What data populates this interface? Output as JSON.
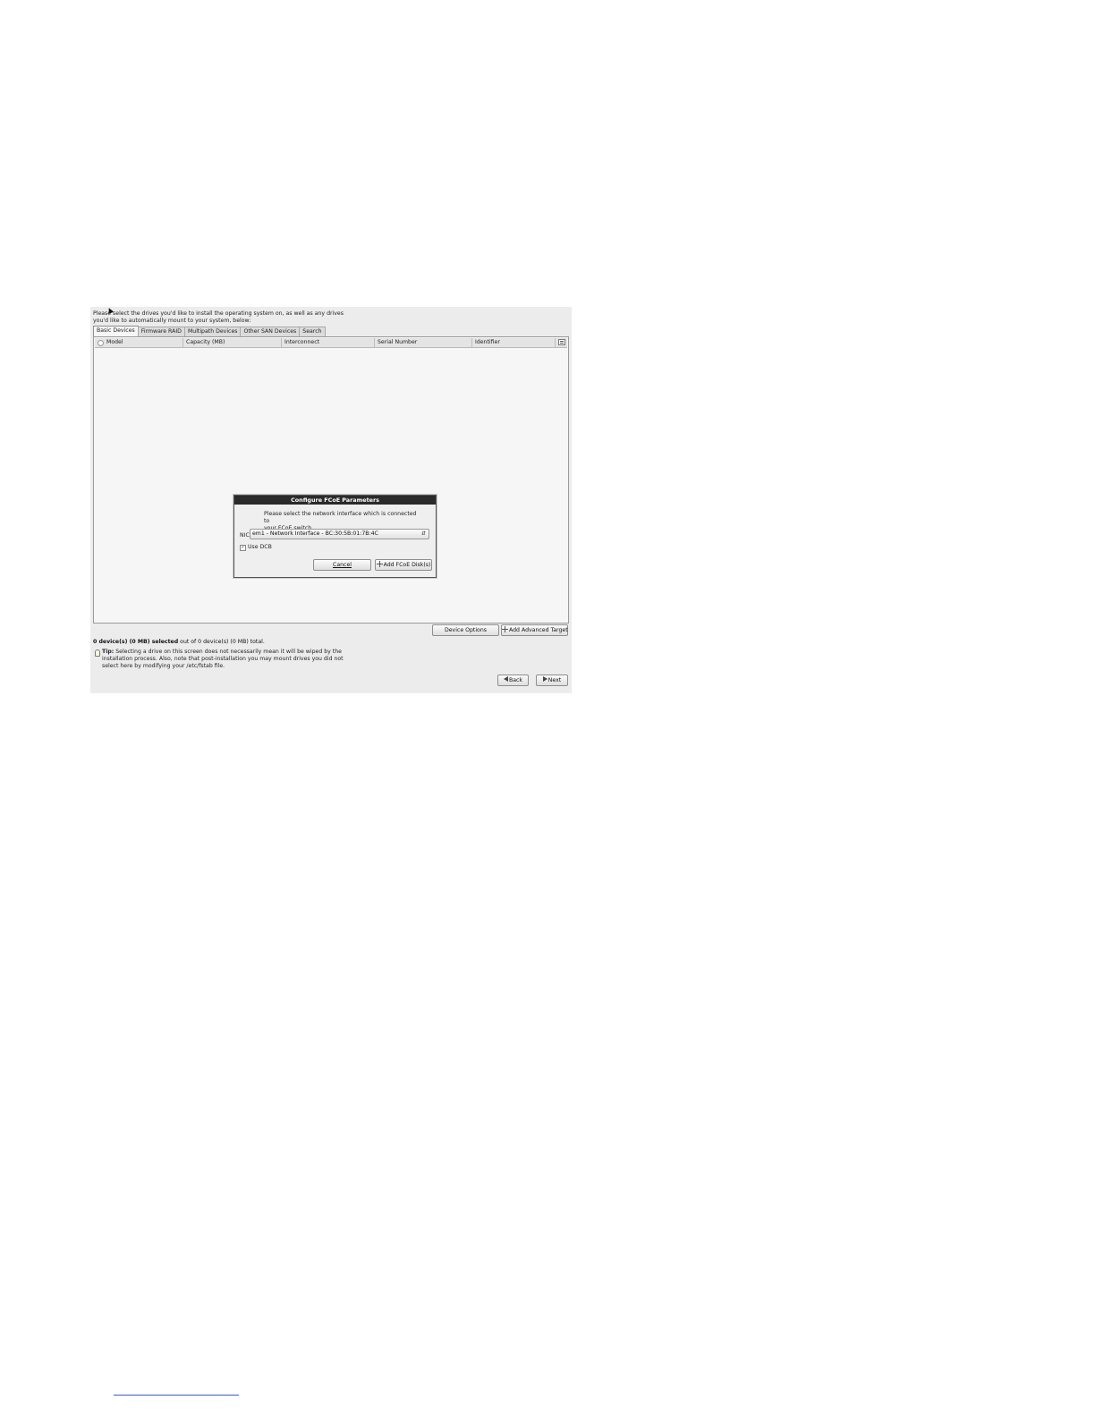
{
  "instruction": {
    "line1": "Please select the drives you'd like to install the operating system on, as well as any drives",
    "line2": "you'd like to automatically mount to your system, below:"
  },
  "tabs": [
    {
      "label": "Basic Devices",
      "active": true
    },
    {
      "label": "Firmware RAID",
      "active": false
    },
    {
      "label": "Multipath Devices",
      "active": false
    },
    {
      "label": "Other SAN Devices",
      "active": false
    },
    {
      "label": "Search",
      "active": false
    }
  ],
  "table": {
    "columns": [
      "Model",
      "Capacity (MB)",
      "Interconnect",
      "Serial Number",
      "Identifier"
    ]
  },
  "dialog": {
    "title": "Configure FCoE Parameters",
    "message_line1": "Please select the network interface which is connected to",
    "message_line2": "your FCoE switch.",
    "nic_label": "NIC:",
    "nic_value": "em1 - Network Interface - BC:30:5B:01:7B:4C",
    "use_dcb_label": "Use DCB",
    "use_dcb_checked": true,
    "cancel_label": "Cancel",
    "add_label": "Add FCoE Disk(s)"
  },
  "actions": {
    "device_options_label": "Device Options",
    "add_advanced_target_label": "Add Advanced Target"
  },
  "status": {
    "selected_bold": "0 device(s) (0 MB) selected",
    "rest": " out of 0 device(s) (0 MB) total."
  },
  "tip": {
    "label": "Tip:",
    "line1": " Selecting a drive on this screen does not necessarily mean it will be wiped by the",
    "line2": "installation process.  Also, note that post-installation you may mount drives you did not",
    "line3": "select here by modifying your /etc/fstab file."
  },
  "nav": {
    "back_label": "Back",
    "next_label": "Next"
  }
}
